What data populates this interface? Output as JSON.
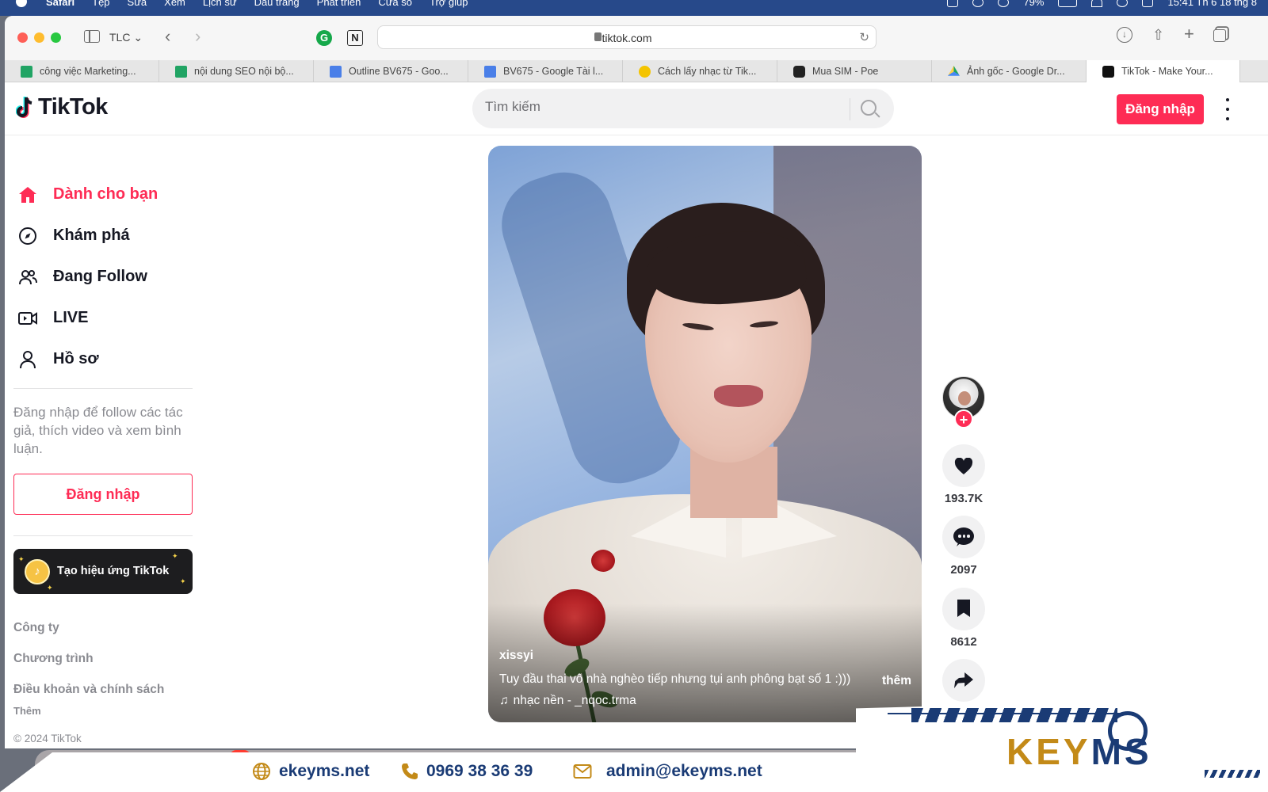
{
  "menubar": {
    "app_name": "Safari",
    "menus": [
      "Tệp",
      "Sửa",
      "Xem",
      "Lịch sử",
      "Dấu trang",
      "Phát triển",
      "Cửa sổ",
      "Trợ giúp"
    ],
    "battery": "79%",
    "clock": "15:41 Th 6 18 thg 8"
  },
  "toolbar": {
    "profile": "TLC",
    "url": "tiktok.com"
  },
  "tabs": [
    {
      "label": "công việc Marketing...",
      "icon": "sheets-icon"
    },
    {
      "label": "nội dung SEO nội bộ...",
      "icon": "sheets-icon"
    },
    {
      "label": "Outline BV675 - Goo...",
      "icon": "docs-icon"
    },
    {
      "label": "BV675 - Google Tài l...",
      "icon": "docs-icon"
    },
    {
      "label": "Cách lấy nhạc từ Tik...",
      "icon": "runner-icon"
    },
    {
      "label": "Mua SIM - Poe",
      "icon": "poe-icon"
    },
    {
      "label": "Ảnh gốc - Google Dr...",
      "icon": "drive-icon"
    },
    {
      "label": "TikTok - Make Your...",
      "icon": "tiktok-icon"
    }
  ],
  "header": {
    "logo_text": "TikTok",
    "search_placeholder": "Tìm kiếm",
    "login_label": "Đăng nhập"
  },
  "sidebar": {
    "items": [
      {
        "label": "Dành cho bạn",
        "icon": "home-icon",
        "active": true
      },
      {
        "label": "Khám phá",
        "icon": "compass-icon"
      },
      {
        "label": "Đang Follow",
        "icon": "following-icon"
      },
      {
        "label": "LIVE",
        "icon": "live-icon"
      },
      {
        "label": "Hồ sơ",
        "icon": "profile-icon"
      }
    ],
    "login_hint": "Đăng nhập để follow các tác giả, thích video và xem bình luận.",
    "login_label": "Đăng nhập",
    "effect_label": "Tạo hiệu ứng TikTok",
    "footer_links": [
      "Công ty",
      "Chương trình",
      "Điều khoản và chính sách"
    ],
    "footer_more": "Thêm",
    "copyright": "© 2024 TikTok"
  },
  "video": {
    "author": "xissyi",
    "caption": "Tuy đầu thai vô nhà nghèo tiếp nhưng tụi anh phông bạt số 1 :)))",
    "more_label": "thêm",
    "music_glyph": "♫",
    "music": "nhạc nền - _nqoc.trma"
  },
  "actions": {
    "likes": "193.7K",
    "comments": "2097",
    "saves": "8612"
  },
  "watermark": {
    "website": "ekeyms.net",
    "phone": "0969 38 36 39",
    "email": "admin@ekeyms.net",
    "logo_left": "KEY",
    "logo_right": "MS",
    "brand_color_primary": "#1a3b75",
    "brand_color_accent": "#c38a18"
  },
  "colors": {
    "tiktok_red": "#fe2c55",
    "menubar_blue": "#27498a"
  }
}
